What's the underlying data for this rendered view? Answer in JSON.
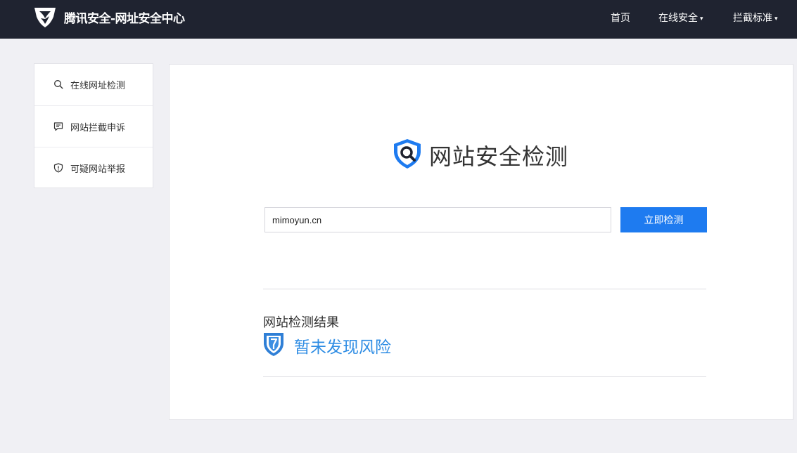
{
  "header": {
    "brand": "腾讯安全-网址安全中心",
    "nav": [
      {
        "label": "首页"
      },
      {
        "label": "在线安全",
        "caret": "▾"
      },
      {
        "label": "拦截标准",
        "caret": "▾"
      }
    ]
  },
  "sidebar": {
    "items": [
      {
        "label": "在线网址检测",
        "icon": "search-icon"
      },
      {
        "label": "网站拦截申诉",
        "icon": "message-icon"
      },
      {
        "label": "可疑网站举报",
        "icon": "shield-alert-icon"
      }
    ]
  },
  "main": {
    "title": "网站安全检测",
    "input_value": "mimoyun.cn",
    "button_label": "立即检测",
    "result": {
      "title": "网站检测结果",
      "status": "暂未发现风险",
      "status_icon": "safe-shield-icon"
    }
  },
  "colors": {
    "header_bg": "#1f2330",
    "accent": "#1e7bf0",
    "status": "#2f8de4",
    "page_bg": "#f0f0f4"
  }
}
